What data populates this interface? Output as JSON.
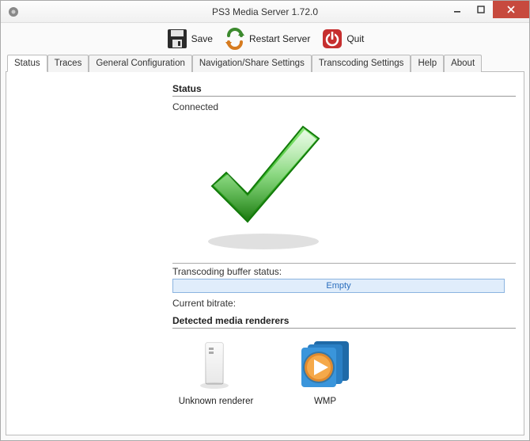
{
  "window": {
    "title": "PS3 Media Server 1.72.0"
  },
  "toolbar": {
    "save_label": "Save",
    "restart_label": "Restart Server",
    "quit_label": "Quit"
  },
  "tabs": [
    {
      "label": "Status",
      "active": true
    },
    {
      "label": "Traces"
    },
    {
      "label": "General Configuration"
    },
    {
      "label": "Navigation/Share Settings"
    },
    {
      "label": "Transcoding Settings"
    },
    {
      "label": "Help"
    },
    {
      "label": "About"
    }
  ],
  "status": {
    "heading": "Status",
    "connection": "Connected",
    "buffer_label": "Transcoding buffer status:",
    "buffer_value": "Empty",
    "bitrate_label": "Current bitrate:"
  },
  "renderers": {
    "heading": "Detected media renderers",
    "items": [
      {
        "label": "Unknown renderer"
      },
      {
        "label": "WMP"
      }
    ]
  }
}
